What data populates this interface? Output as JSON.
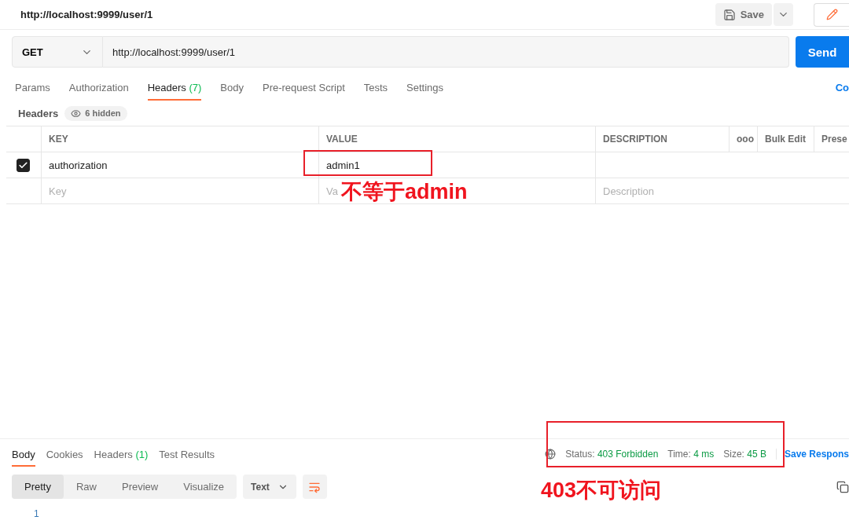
{
  "title": "http://localhost:9999/user/1",
  "save_button": "Save",
  "request": {
    "method": "GET",
    "url": "http://localhost:9999/user/1",
    "send": "Send"
  },
  "request_tabs": [
    {
      "label": "Params",
      "selected": false
    },
    {
      "label": "Authorization",
      "selected": false
    },
    {
      "label": "Headers",
      "count": "(7)",
      "selected": true
    },
    {
      "label": "Body",
      "selected": false
    },
    {
      "label": "Pre-request Script",
      "selected": false
    },
    {
      "label": "Tests",
      "selected": false
    },
    {
      "label": "Settings",
      "selected": false
    }
  ],
  "code_link": "Co",
  "headers_bar": {
    "label": "Headers",
    "hidden": "6 hidden"
  },
  "table": {
    "columns": [
      "KEY",
      "VALUE",
      "DESCRIPTION"
    ],
    "more": "ooo",
    "bulk_edit": "Bulk Edit",
    "presets": "Prese",
    "rows": [
      {
        "checked": true,
        "key": "authorization",
        "value": "admin1",
        "description": ""
      }
    ],
    "new_row": {
      "key_placeholder": "Key",
      "value_placeholder": "Va",
      "description_placeholder": "Description"
    }
  },
  "response_tabs": [
    {
      "label": "Body",
      "selected": true
    },
    {
      "label": "Cookies",
      "selected": false
    },
    {
      "label": "Headers",
      "count": "(1)",
      "selected": false
    },
    {
      "label": "Test Results",
      "selected": false
    }
  ],
  "status": [
    {
      "label": "Status:",
      "value": "403 Forbidden"
    },
    {
      "label": "Time:",
      "value": "4 ms"
    },
    {
      "label": "Size:",
      "value": "45 B"
    }
  ],
  "save_response": "Save Respons",
  "view_modes": [
    {
      "label": "Pretty",
      "selected": true
    },
    {
      "label": "Raw",
      "selected": false
    },
    {
      "label": "Preview",
      "selected": false
    },
    {
      "label": "Visualize",
      "selected": false
    }
  ],
  "format": "Text",
  "line_numbers": [
    "1"
  ],
  "annotations": [
    {
      "text": "不等于admin"
    },
    {
      "text": "403不可访问"
    }
  ]
}
